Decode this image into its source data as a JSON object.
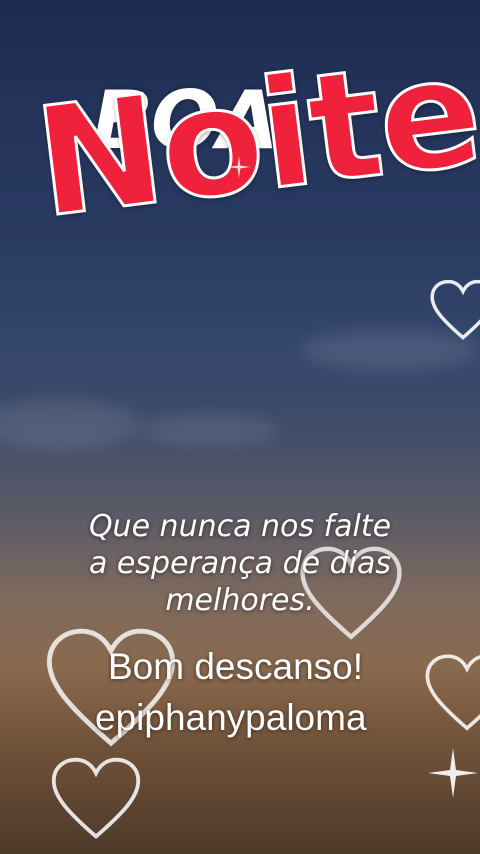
{
  "greeting": {
    "line1": "BOA",
    "line2": "Noite"
  },
  "quote": {
    "lines": [
      "Que nunca nos falte",
      "a esperança de dias",
      "melhores."
    ]
  },
  "sign_off": "Bom descanso!",
  "signature": "epiphanypaloma",
  "colors": {
    "noite_red": "#f0213a",
    "text_white": "#ffffff",
    "sky_top": "#1c2a4e",
    "sky_bottom": "#4e3a2a"
  },
  "decorations": [
    "heart-outline-icon",
    "sparkle-icon"
  ]
}
